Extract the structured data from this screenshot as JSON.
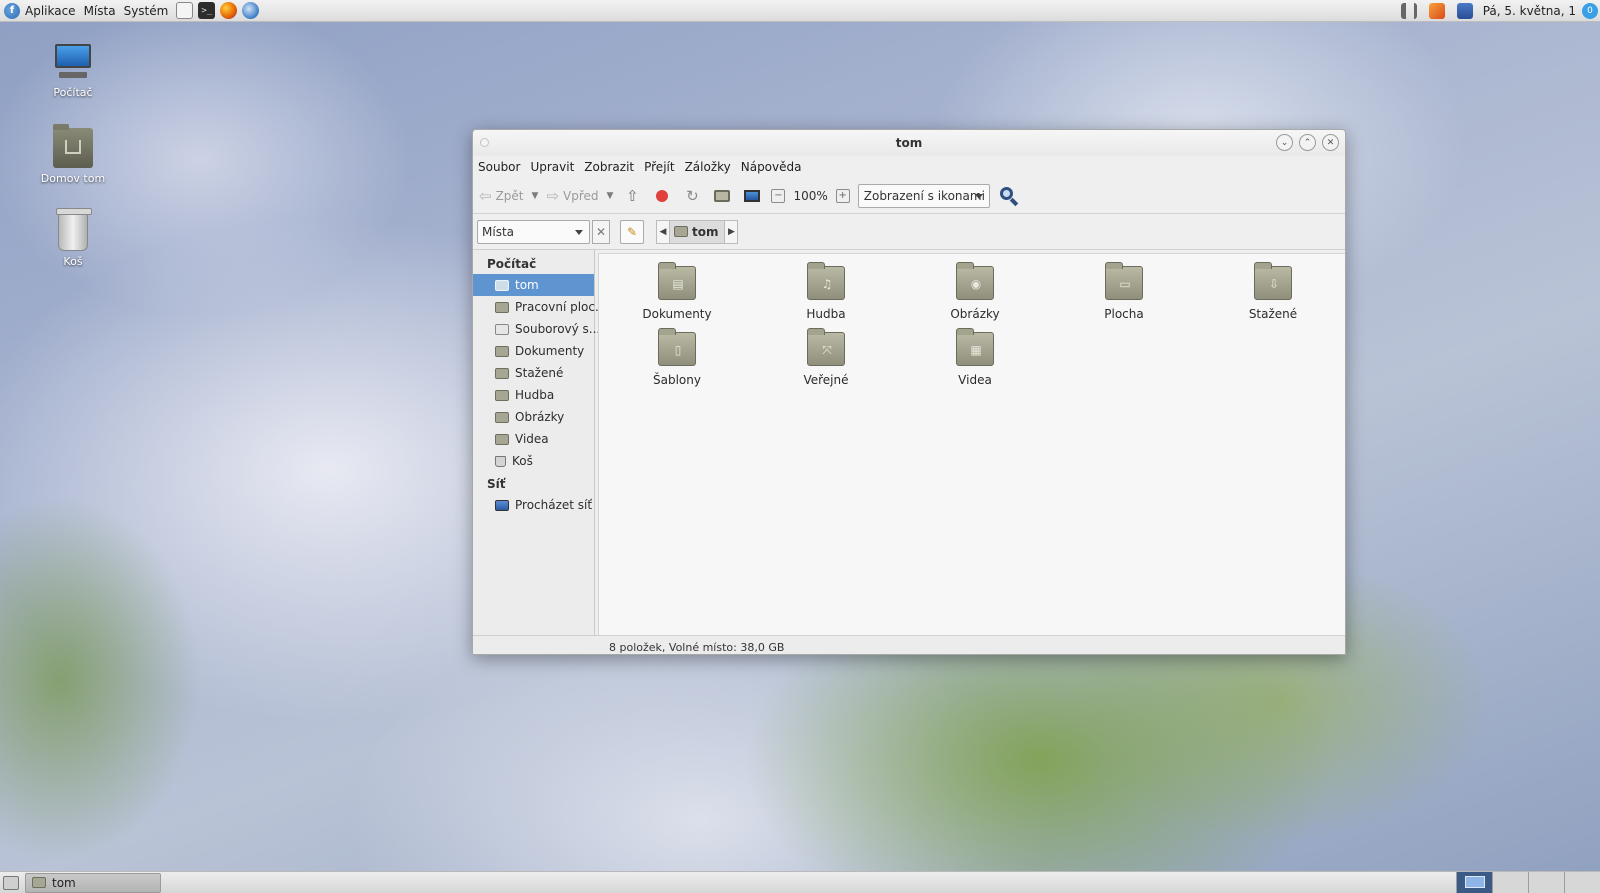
{
  "top_panel": {
    "menus": [
      "Aplikace",
      "Místa",
      "Systém"
    ],
    "clock": "Pá, 5. května, 1",
    "notify_badge": "0"
  },
  "desktop": {
    "icons": [
      {
        "label": "Počítač"
      },
      {
        "label": "Domov tom"
      },
      {
        "label": "Koš"
      }
    ]
  },
  "window": {
    "title": "tom",
    "menubar": [
      "Soubor",
      "Upravit",
      "Zobrazit",
      "Přejít",
      "Záložky",
      "Nápověda"
    ],
    "toolbar": {
      "back_label": "Zpět",
      "forward_label": "Vpřed",
      "zoom_level": "100%",
      "view_mode": "Zobrazení s ikonami"
    },
    "location": {
      "places_label": "Místa",
      "current_folder": "tom"
    },
    "sidebar": {
      "computer_heading": "Počítač",
      "computer_items": [
        {
          "label": "tom",
          "icon": "home-folder-icon",
          "selected": true
        },
        {
          "label": "Pracovní ploc...",
          "icon": "desktop-folder-icon"
        },
        {
          "label": "Souborový s...",
          "icon": "filesystem-icon"
        },
        {
          "label": "Dokumenty",
          "icon": "documents-folder-icon"
        },
        {
          "label": "Stažené",
          "icon": "downloads-folder-icon"
        },
        {
          "label": "Hudba",
          "icon": "music-folder-icon"
        },
        {
          "label": "Obrázky",
          "icon": "pictures-folder-icon"
        },
        {
          "label": "Videa",
          "icon": "videos-folder-icon"
        },
        {
          "label": "Koš",
          "icon": "trash-icon"
        }
      ],
      "network_heading": "Síť",
      "network_items": [
        {
          "label": "Procházet síť",
          "icon": "network-icon"
        }
      ]
    },
    "files": [
      {
        "label": "Dokumenty",
        "icon": "documents-folder-icon"
      },
      {
        "label": "Hudba",
        "icon": "music-folder-icon"
      },
      {
        "label": "Obrázky",
        "icon": "pictures-folder-icon"
      },
      {
        "label": "Plocha",
        "icon": "desktop-folder-icon"
      },
      {
        "label": "Stažené",
        "icon": "downloads-folder-icon"
      },
      {
        "label": "Šablony",
        "icon": "templates-folder-icon"
      },
      {
        "label": "Veřejné",
        "icon": "public-folder-icon"
      },
      {
        "label": "Videa",
        "icon": "videos-folder-icon"
      }
    ],
    "status": "8 položek, Volné místo: 38,0 GB"
  },
  "bottom_panel": {
    "task_label": "tom"
  }
}
